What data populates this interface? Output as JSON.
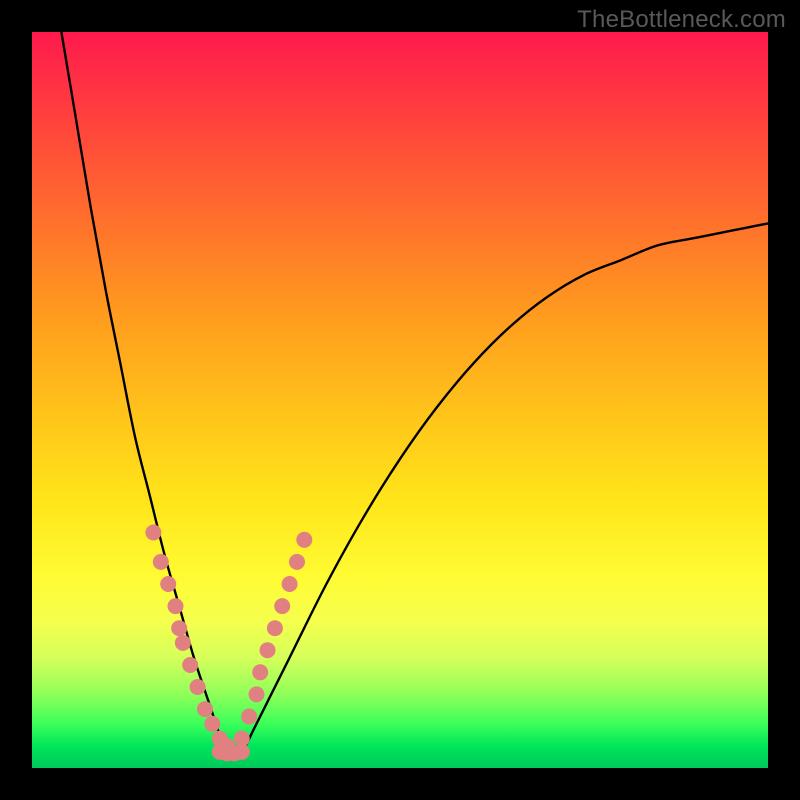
{
  "watermark": "TheBottleneck.com",
  "chart_data": {
    "type": "line",
    "title": "",
    "xlabel": "",
    "ylabel": "",
    "xlim": [
      0,
      100
    ],
    "ylim": [
      0,
      100
    ],
    "grid": false,
    "legend": false,
    "note": "Two smooth black curves descending to a common minimum near (27, 2). Salmon dots highlight the lower portions of both curves. No axis ticks or numeric labels are shown in the source image; x/y values below are estimated from pixel positions on a 0–100 normalized grid.",
    "series": [
      {
        "name": "left-curve",
        "x": [
          4,
          6,
          8,
          10,
          12,
          14,
          16,
          18,
          20,
          22,
          24,
          25,
          26,
          27
        ],
        "y": [
          100,
          88,
          76,
          65,
          55,
          45,
          37,
          29,
          22,
          15,
          9,
          6,
          3,
          2
        ]
      },
      {
        "name": "right-curve",
        "x": [
          28,
          29,
          30,
          32,
          35,
          40,
          45,
          50,
          55,
          60,
          65,
          70,
          75,
          80,
          85,
          90,
          95,
          100
        ],
        "y": [
          2,
          3,
          5,
          9,
          15,
          25,
          34,
          42,
          49,
          55,
          60,
          64,
          67,
          69,
          71,
          72,
          73,
          74
        ]
      },
      {
        "name": "left-dots",
        "x": [
          16.5,
          17.5,
          18.5,
          19.5,
          20.0,
          20.5,
          21.5,
          22.5,
          23.5,
          24.5,
          25.5,
          26.5
        ],
        "y": [
          32,
          28,
          25,
          22,
          19,
          17,
          14,
          11,
          8,
          6,
          4,
          3
        ]
      },
      {
        "name": "right-dots",
        "x": [
          28.5,
          29.5,
          30.5,
          31.0,
          32.0,
          33.0,
          34.0,
          35.0,
          36.0,
          37.0
        ],
        "y": [
          4,
          7,
          10,
          13,
          16,
          19,
          22,
          25,
          28,
          31
        ]
      },
      {
        "name": "bottom-dots",
        "x": [
          25.5,
          26.5,
          27.5,
          28.5
        ],
        "y": [
          2.2,
          2.0,
          2.0,
          2.2
        ]
      }
    ],
    "colors": {
      "curve": "#000000",
      "dots": "#e08080",
      "gradient_top": "#ff1a4d",
      "gradient_mid": "#ffe61a",
      "gradient_bottom": "#00c95a"
    }
  }
}
